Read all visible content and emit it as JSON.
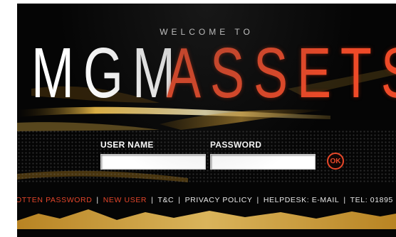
{
  "header": {
    "welcome": "WELCOME TO",
    "brand_part1": "MGM",
    "brand_part2": "ASSETS"
  },
  "login": {
    "username_label": "USER NAME",
    "password_label": "PASSWORD",
    "username_value": "",
    "password_value": "",
    "ok_label": "OK"
  },
  "footer_links": {
    "forgotten_password": "OTTEN PASSWORD",
    "new_user": "NEW USER",
    "terms": "T&C",
    "privacy": "PRIVACY POLICY",
    "helpdesk": "HELPDESK: E-MAIL",
    "tel": "TEL: 01895"
  },
  "colors": {
    "background": "#050505",
    "brand_red": "#ee4a28",
    "gold": "#f2c14a"
  }
}
